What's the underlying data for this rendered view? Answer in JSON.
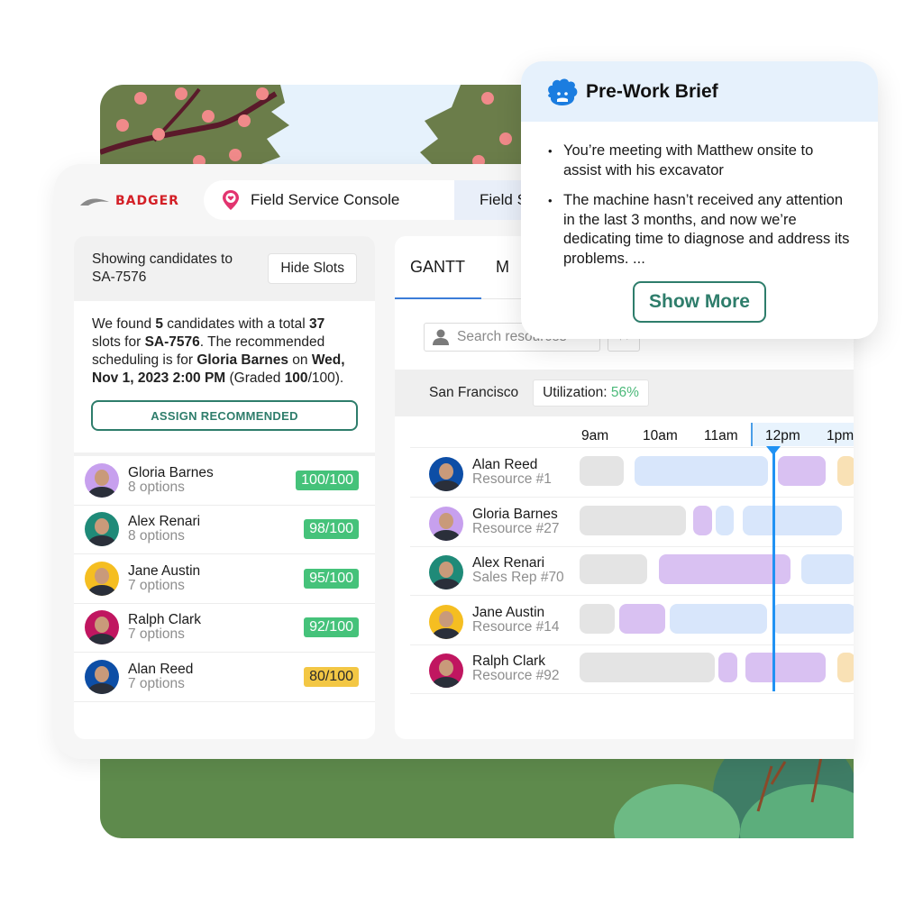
{
  "brand": {
    "logo_text": "BADGER",
    "logo_color": "#d31f26"
  },
  "app_tabs": [
    {
      "label": "Field Service Console",
      "icon": "map-pin-heart-icon",
      "active": true
    },
    {
      "label": "Field S"
    }
  ],
  "candidates_panel": {
    "header_text": "Showing candidates to SA-7576",
    "hide_slots_label": "Hide Slots",
    "summary": {
      "p1": "We found ",
      "count": "5",
      "p2": " candidates with a total ",
      "slots": "37",
      "p3": " slots for ",
      "appointment": "SA-7576",
      "p4": ". The recommended scheduling is for ",
      "recommended": "Gloria Barnes",
      "p5": " on ",
      "datetime": "Wed, Nov 1, 2023 2:00 PM",
      "p6": " (Graded ",
      "grade": "100",
      "p7": "/100)."
    },
    "assign_label": "ASSIGN RECOMMENDED",
    "candidates": [
      {
        "name": "Gloria Barnes",
        "options": "8 options",
        "score": "100/100",
        "status": "good",
        "avatar_color": "#c7a0ee"
      },
      {
        "name": "Alex Renari",
        "options": "8 options",
        "score": "98/100",
        "status": "good",
        "avatar_color": "#1f8a78"
      },
      {
        "name": "Jane Austin",
        "options": "7 options",
        "score": "95/100",
        "status": "good",
        "avatar_color": "#f5be21"
      },
      {
        "name": "Ralph Clark",
        "options": "7 options",
        "score": "92/100",
        "status": "good",
        "avatar_color": "#c01660"
      },
      {
        "name": "Alan Reed",
        "options": "7 options",
        "score": "80/100",
        "status": "warn",
        "avatar_color": "#0d4ea6"
      }
    ]
  },
  "gantt_panel": {
    "tabs": [
      {
        "label": "GANTT",
        "active": true
      },
      {
        "label": "M"
      }
    ],
    "search_placeholder": "Search resources",
    "filter_label": "↑ ▾",
    "region": "San Francisco",
    "utilization_label": "Utilization: ",
    "utilization_value": "56%",
    "hours": [
      "9am",
      "10am",
      "11am",
      "12pm",
      "1pm"
    ],
    "current_time_hour": "12pm",
    "resources": [
      {
        "name": "Alan Reed",
        "sub": "Resource #1",
        "avatar_color": "#0d4ea6",
        "bars": [
          {
            "type": "idle",
            "start": 0.0,
            "end": 0.72
          },
          {
            "type": "travel",
            "start": 0.9,
            "end": 3.08
          },
          {
            "type": "work",
            "start": 3.24,
            "end": 4.02
          },
          {
            "type": "break",
            "start": 4.2,
            "end": 4.5
          }
        ]
      },
      {
        "name": "Gloria Barnes",
        "sub": "Resource #27",
        "avatar_color": "#c7a0ee",
        "bars": [
          {
            "type": "idle",
            "start": 0.0,
            "end": 1.73
          },
          {
            "type": "work",
            "start": 1.86,
            "end": 2.16
          },
          {
            "type": "travel",
            "start": 2.22,
            "end": 2.52
          },
          {
            "type": "travel",
            "start": 2.66,
            "end": 4.28
          }
        ]
      },
      {
        "name": "Alex Renari",
        "sub": "Sales Rep #70",
        "avatar_color": "#1f8a78",
        "bars": [
          {
            "type": "idle",
            "start": 0.0,
            "end": 1.1
          },
          {
            "type": "work",
            "start": 1.3,
            "end": 3.44
          },
          {
            "type": "travel",
            "start": 3.62,
            "end": 4.5
          }
        ]
      },
      {
        "name": "Jane Austin",
        "sub": "Resource #14",
        "avatar_color": "#f5be21",
        "bars": [
          {
            "type": "idle",
            "start": 0.0,
            "end": 0.58
          },
          {
            "type": "work",
            "start": 0.64,
            "end": 1.4
          },
          {
            "type": "travel",
            "start": 1.47,
            "end": 3.06
          },
          {
            "type": "travel",
            "start": 3.14,
            "end": 4.5
          }
        ]
      },
      {
        "name": "Ralph Clark",
        "sub": "Resource #92",
        "avatar_color": "#c01660",
        "bars": [
          {
            "type": "idle",
            "start": 0.0,
            "end": 2.2
          },
          {
            "type": "work",
            "start": 2.27,
            "end": 2.58
          },
          {
            "type": "work",
            "start": 2.7,
            "end": 4.02
          },
          {
            "type": "break",
            "start": 4.2,
            "end": 4.5
          }
        ]
      }
    ]
  },
  "brief": {
    "title": "Pre-Work Brief",
    "icon": "einstein-icon",
    "bullets": [
      "You’re meeting with Matthew onsite to assist with his excavator",
      "The machine hasn’t received any attention in the last 3 months, and now we’re dedicating time to diagnose and address its problems. ..."
    ],
    "show_more_label": "Show More"
  },
  "colors": {
    "accent_green": "#2e7d6b",
    "score_good": "#45c27a",
    "score_warn": "#f3c744",
    "now_line": "#2192f3"
  }
}
